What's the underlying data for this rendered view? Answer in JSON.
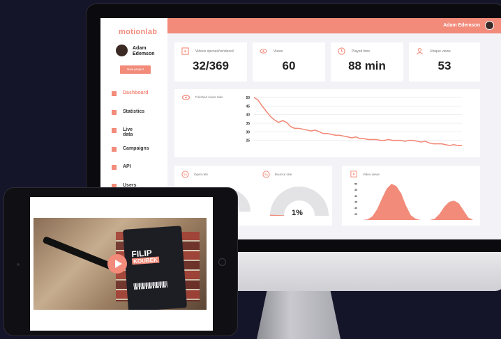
{
  "brand": {
    "logo": "motionlab",
    "accent": "#f28b7a"
  },
  "user": {
    "name": "Adam Edemson",
    "first": "Adam",
    "last": "Edemson"
  },
  "sidebar": {
    "new_project": "New project",
    "items": [
      {
        "label": "Dashboard",
        "active": true
      },
      {
        "label": "Statistics"
      },
      {
        "label": "Live data"
      },
      {
        "label": "Campaigns"
      },
      {
        "label": "API"
      },
      {
        "label": "Users"
      }
    ]
  },
  "stats": [
    {
      "label": "Videos opened/rendered",
      "value": "32/369",
      "icon": "play-icon"
    },
    {
      "label": "Views",
      "value": "60",
      "icon": "eye-icon"
    },
    {
      "label": "Played time",
      "value": "88 min",
      "icon": "clock-icon"
    },
    {
      "label": "Unique views",
      "value": "53",
      "icon": "user-icon"
    }
  ],
  "finished_ratio": {
    "label": "Finished views ratio"
  },
  "open_rate": {
    "label": "Open rate",
    "fill": 0.5
  },
  "bounce_rate": {
    "label": "Bounce rate",
    "value": "1%",
    "fill": 0.01
  },
  "video_views": {
    "label": "Video views"
  },
  "badge": {
    "first": "FILIP",
    "last": "KOUBEK"
  },
  "chart_data": [
    {
      "type": "line",
      "title": "Finished views ratio",
      "yticks": [
        50,
        45,
        40,
        35,
        30,
        25
      ],
      "ylim": [
        20,
        50
      ],
      "grid": true,
      "values": [
        50,
        48.5,
        45,
        42,
        39,
        37,
        35.5,
        36.5,
        35.5,
        33,
        32,
        32,
        31.5,
        31,
        30.5,
        31,
        30,
        29,
        29,
        28.5,
        28,
        28,
        27.5,
        27,
        26.5,
        27,
        26,
        26,
        25.5,
        25.5,
        25.5,
        25,
        25,
        25.5,
        25,
        25,
        25,
        24.5,
        25,
        25,
        24.5,
        24,
        24.5,
        23.5,
        23,
        23,
        23,
        22.5,
        22,
        22.5,
        22,
        22
      ]
    },
    {
      "type": "area",
      "title": "Video views",
      "yticks": [
        50,
        45,
        40,
        35,
        30,
        25
      ],
      "ylim": [
        20,
        50
      ],
      "values": [
        20,
        20.5,
        23,
        29,
        38,
        46,
        50,
        48,
        42,
        32,
        24,
        21,
        20,
        20,
        20,
        21,
        25,
        31,
        35,
        36,
        34,
        28,
        22,
        20
      ]
    }
  ]
}
